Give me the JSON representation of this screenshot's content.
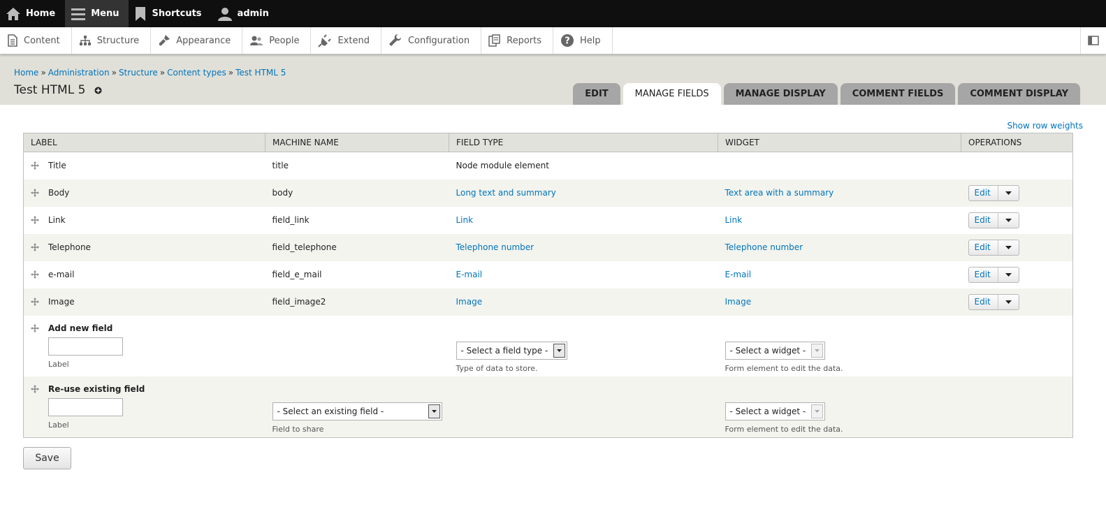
{
  "toolbar": {
    "home": "Home",
    "menu": "Menu",
    "shortcuts": "Shortcuts",
    "user": "admin"
  },
  "tray": {
    "items": [
      "Content",
      "Structure",
      "Appearance",
      "People",
      "Extend",
      "Configuration",
      "Reports",
      "Help"
    ]
  },
  "breadcrumb": [
    "Home",
    "Administration",
    "Structure",
    "Content types",
    "Test HTML 5"
  ],
  "breadcrumb_sep": "»",
  "page_title": "Test HTML 5",
  "tabs": [
    "EDIT",
    "MANAGE FIELDS",
    "MANAGE DISPLAY",
    "COMMENT FIELDS",
    "COMMENT DISPLAY"
  ],
  "active_tab": "MANAGE FIELDS",
  "show_row_weights": "Show row weights",
  "table": {
    "headers": [
      "LABEL",
      "MACHINE NAME",
      "FIELD TYPE",
      "WIDGET",
      "OPERATIONS"
    ],
    "rows": [
      {
        "label": "Title",
        "machine": "title",
        "type": "Node module element",
        "widget": "",
        "op": ""
      },
      {
        "label": "Body",
        "machine": "body",
        "type": "Long text and summary",
        "widget": "Text area with a summary",
        "op": "Edit"
      },
      {
        "label": "Link",
        "machine": "field_link",
        "type": "Link",
        "widget": "Link",
        "op": "Edit"
      },
      {
        "label": "Telephone",
        "machine": "field_telephone",
        "type": "Telephone number",
        "widget": "Telephone number",
        "op": "Edit"
      },
      {
        "label": "e-mail",
        "machine": "field_e_mail",
        "type": "E-mail",
        "widget": "E-mail",
        "op": "Edit"
      },
      {
        "label": "Image",
        "machine": "field_image2",
        "type": "Image",
        "widget": "Image",
        "op": "Edit"
      }
    ]
  },
  "add_new": {
    "title": "Add new field",
    "label_desc": "Label",
    "type_select": "- Select a field type -",
    "type_desc": "Type of data to store.",
    "widget_select": "- Select a widget -",
    "widget_desc": "Form element to edit the data."
  },
  "reuse": {
    "title": "Re-use existing field",
    "label_desc": "Label",
    "field_select": "- Select an existing field -",
    "field_desc": "Field to share",
    "widget_select": "- Select a widget -",
    "widget_desc": "Form element to edit the data."
  },
  "save_label": "Save"
}
